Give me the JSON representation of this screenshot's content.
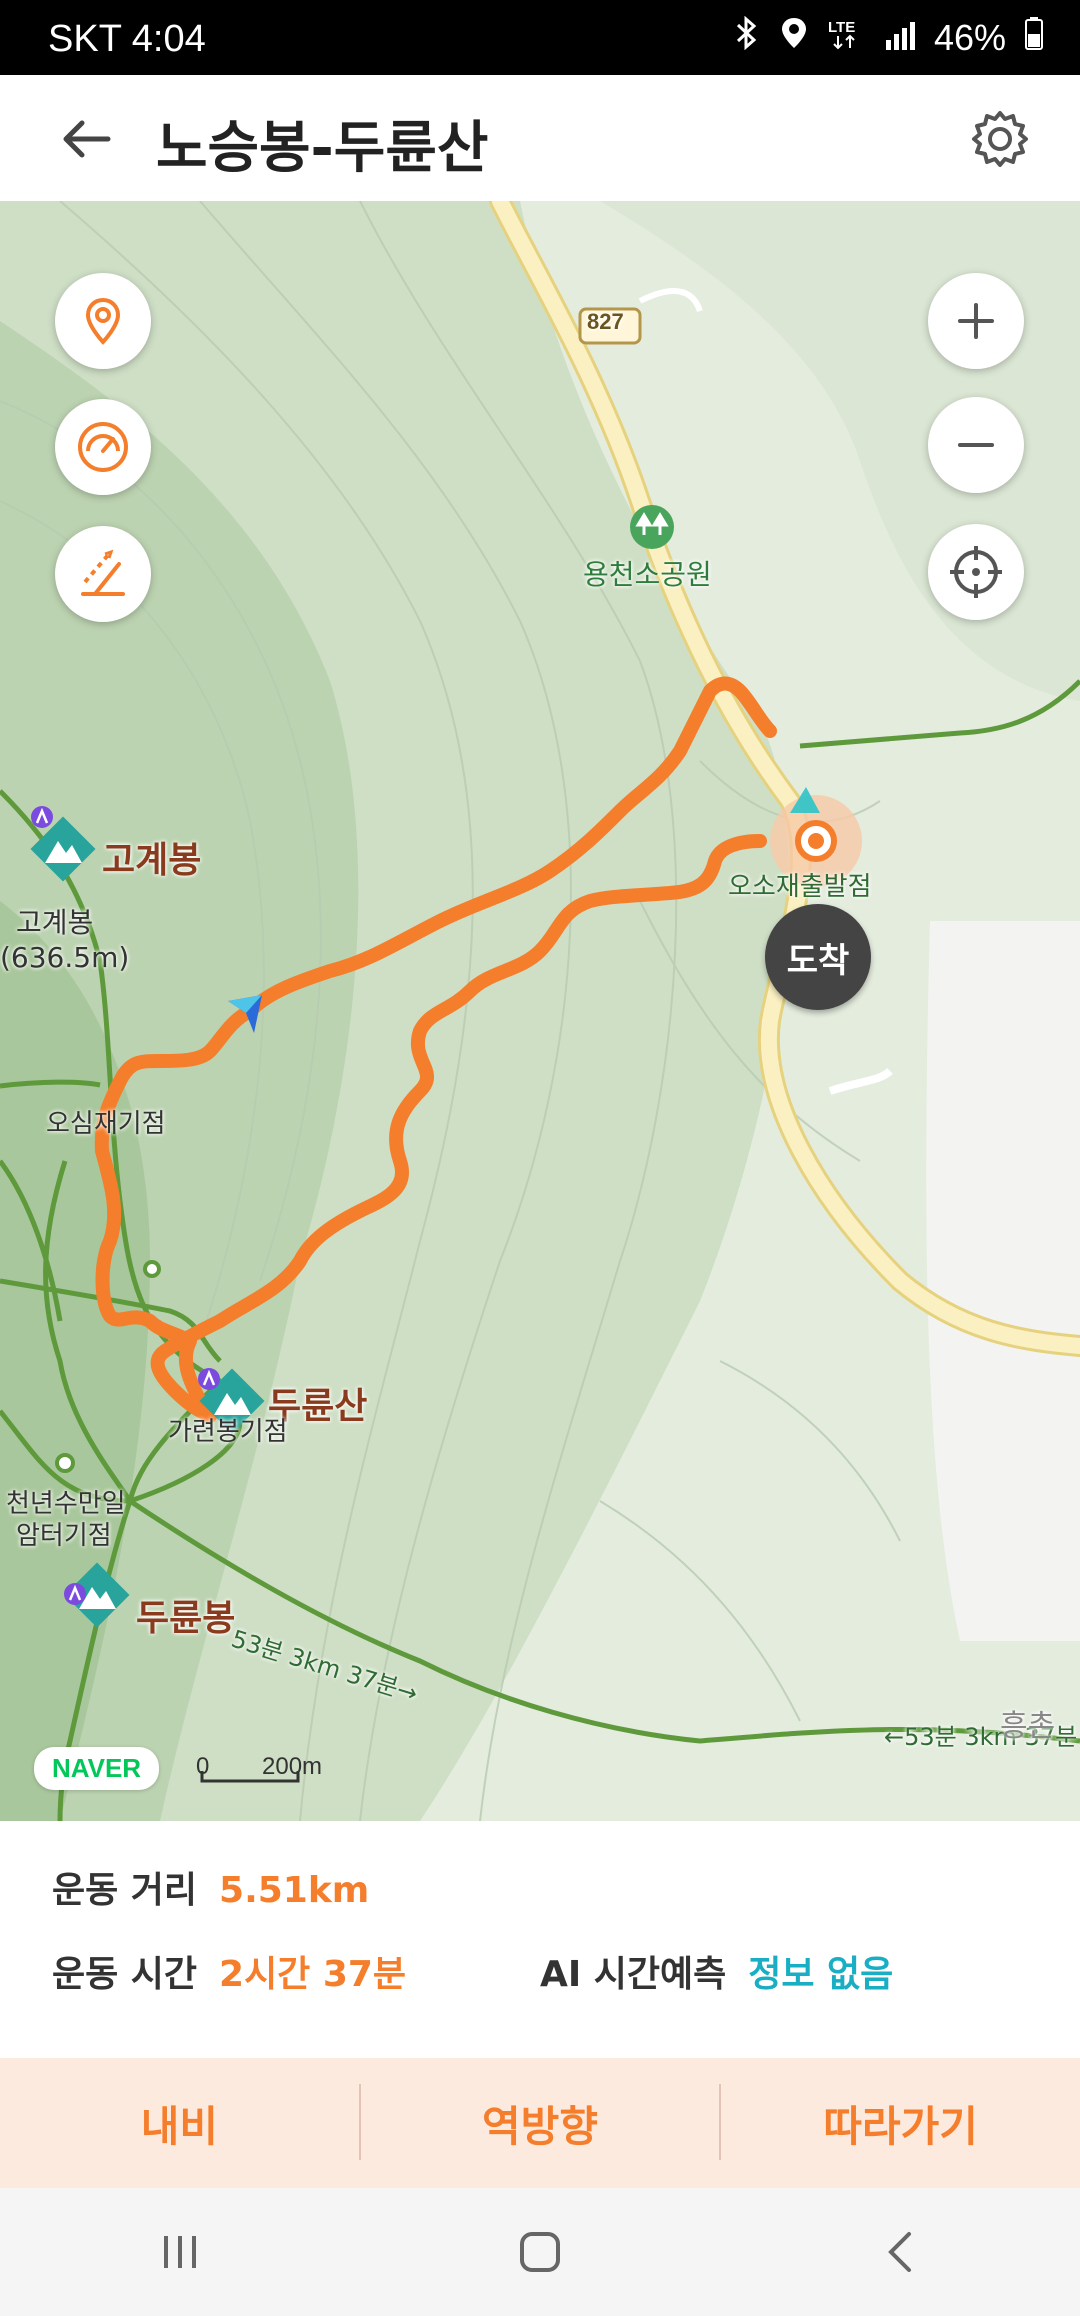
{
  "status_bar": {
    "carrier_time": "SKT 4:04",
    "battery": "46%"
  },
  "header": {
    "title": "노승봉-두륜산",
    "back_icon": "arrow-left-icon",
    "settings_icon": "gear-icon"
  },
  "map": {
    "road_number": "827",
    "labels": {
      "park": "용천소공원",
      "arrive_badge": "도착",
      "start_point": "오소재출발점",
      "gogyebong_title": "고계봉",
      "gogyebong_name": "고계봉",
      "gogyebong_height": "(636.5m)",
      "osimjae": "오심재기점",
      "duryunsan": "두륜산",
      "garyeon": "가련봉기점",
      "cheonnyeon_1": "천년수만일",
      "cheonnyeon_2": "암터기점",
      "duryunbong": "두륜봉",
      "trail_left": "53분 3km 37분→",
      "trail_right": "←53분 3km 37분",
      "heung": "흥촌"
    },
    "brand": "NAVER",
    "scale_zero": "0",
    "scale_value": "200m",
    "colors": {
      "route": "#f47e2b",
      "trail": "#5e9a3c",
      "road": "#f7e7a3"
    }
  },
  "map_controls": {
    "left": [
      "location-pin-icon",
      "speedometer-icon",
      "elevation-icon"
    ],
    "right": [
      "zoom-in-icon",
      "zoom-out-icon",
      "crosshair-icon"
    ]
  },
  "stats": {
    "distance_label": "운동 거리",
    "distance_value": "5.51km",
    "time_label": "운동 시간",
    "time_value": "2시간 37분",
    "ai_label": "AI 시간예측",
    "ai_value": "정보 없음"
  },
  "actions": {
    "navi": "내비",
    "reverse": "역방향",
    "follow": "따라가기"
  }
}
